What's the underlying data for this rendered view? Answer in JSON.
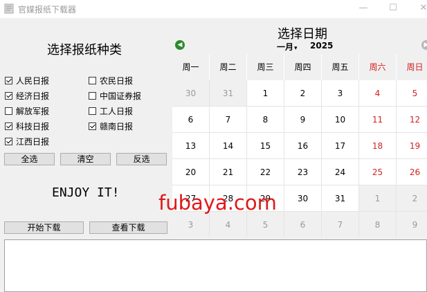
{
  "window": {
    "title": "官媒报纸下载器",
    "minimize_glyph": "—",
    "maximize_glyph": "☐",
    "close_glyph": "✕"
  },
  "left": {
    "title": "选择报纸种类",
    "newspapers": [
      {
        "label": "人民日报",
        "checked": true
      },
      {
        "label": "农民日报",
        "checked": false
      },
      {
        "label": "经济日报",
        "checked": true
      },
      {
        "label": "中国证券报",
        "checked": false
      },
      {
        "label": "解放军报",
        "checked": false
      },
      {
        "label": "工人日报",
        "checked": false
      },
      {
        "label": "科技日报",
        "checked": true
      },
      {
        "label": "赣南日报",
        "checked": true
      },
      {
        "label": "江西日报",
        "checked": true
      }
    ],
    "select_all": "全选",
    "clear": "清空",
    "invert": "反选",
    "enjoy": "ENJOY IT!",
    "start_download": "开始下载",
    "view_download": "查看下载"
  },
  "calendar": {
    "title": "选择日期",
    "month": "一月",
    "year": "2025",
    "prev_glyph": "◀",
    "next_glyph": "▶",
    "weekdays": [
      "周一",
      "周二",
      "周三",
      "周四",
      "周五",
      "周六",
      "周日"
    ],
    "weeks": [
      [
        "30",
        "31",
        "1",
        "2",
        "3",
        "4",
        "5"
      ],
      [
        "6",
        "7",
        "8",
        "9",
        "10",
        "11",
        "12"
      ],
      [
        "13",
        "14",
        "15",
        "16",
        "17",
        "18",
        "19"
      ],
      [
        "20",
        "21",
        "22",
        "23",
        "24",
        "25",
        "26"
      ],
      [
        "27",
        "28",
        "29",
        "30",
        "31",
        "1",
        "2"
      ],
      [
        "3",
        "4",
        "5",
        "6",
        "7",
        "8",
        "9"
      ]
    ],
    "weekend_color": "#d42020"
  },
  "watermark": "fubaya.com"
}
